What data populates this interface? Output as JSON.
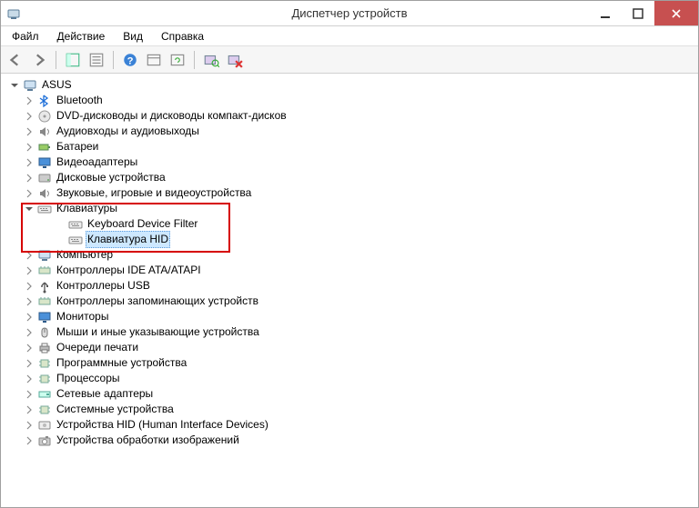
{
  "window": {
    "title": "Диспетчер устройств"
  },
  "menu": {
    "file": "Файл",
    "action": "Действие",
    "view": "Вид",
    "help": "Справка"
  },
  "root": {
    "label": "ASUS"
  },
  "categories": [
    {
      "id": "bluetooth",
      "label": "Bluetooth",
      "icon": "bluetooth"
    },
    {
      "id": "dvd",
      "label": "DVD-дисководы и дисководы компакт-дисков",
      "icon": "disc"
    },
    {
      "id": "audio",
      "label": "Аудиовходы и аудиовыходы",
      "icon": "speaker"
    },
    {
      "id": "battery",
      "label": "Батареи",
      "icon": "battery"
    },
    {
      "id": "video",
      "label": "Видеоадаптеры",
      "icon": "display"
    },
    {
      "id": "disk",
      "label": "Дисковые устройства",
      "icon": "hdd"
    },
    {
      "id": "sound",
      "label": "Звуковые, игровые и видеоустройства",
      "icon": "speaker"
    },
    {
      "id": "keyboards",
      "label": "Клавиатуры",
      "icon": "keyboard",
      "expanded": true,
      "children": [
        {
          "id": "kdf",
          "label": "Keyboard Device Filter",
          "icon": "keyboard",
          "selected": false
        },
        {
          "id": "khid",
          "label": "Клавиатура HID",
          "icon": "keyboard",
          "selected": true
        }
      ]
    },
    {
      "id": "computer",
      "label": "Компьютер",
      "icon": "computer"
    },
    {
      "id": "ide",
      "label": "Контроллеры IDE ATA/ATAPI",
      "icon": "controller"
    },
    {
      "id": "usbctl",
      "label": "Контроллеры USB",
      "icon": "usb"
    },
    {
      "id": "storage-ctl",
      "label": "Контроллеры запоминающих устройств",
      "icon": "controller"
    },
    {
      "id": "monitors",
      "label": "Мониторы",
      "icon": "display"
    },
    {
      "id": "mice",
      "label": "Мыши и иные указывающие устройства",
      "icon": "mouse"
    },
    {
      "id": "printq",
      "label": "Очереди печати",
      "icon": "printer"
    },
    {
      "id": "software",
      "label": "Программные устройства",
      "icon": "chip"
    },
    {
      "id": "cpu",
      "label": "Процессоры",
      "icon": "chip"
    },
    {
      "id": "network",
      "label": "Сетевые адаптеры",
      "icon": "network"
    },
    {
      "id": "system",
      "label": "Системные устройства",
      "icon": "chip"
    },
    {
      "id": "hid",
      "label": "Устройства HID (Human Interface Devices)",
      "icon": "hid"
    },
    {
      "id": "imaging",
      "label": "Устройства обработки изображений",
      "icon": "camera"
    }
  ]
}
